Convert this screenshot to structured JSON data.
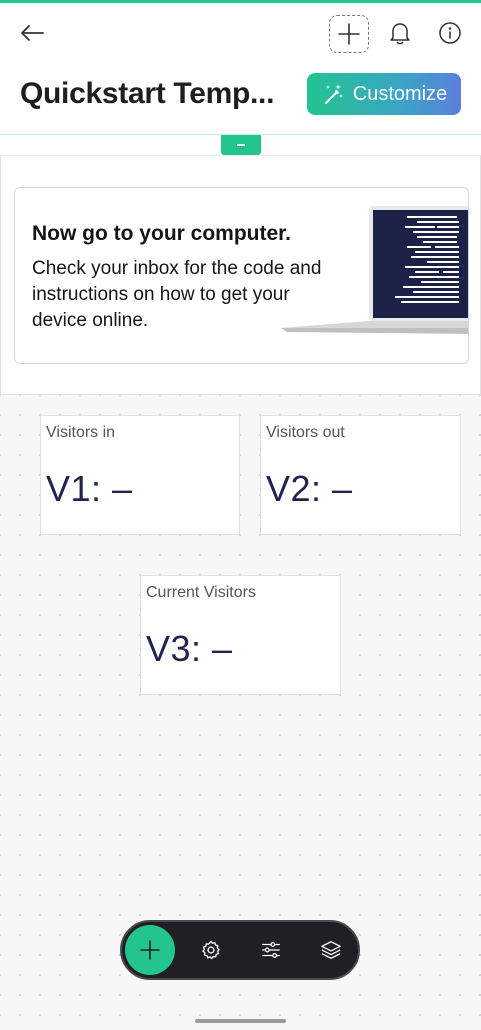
{
  "header": {
    "title": "Quickstart Temp...",
    "customize_label": "Customize",
    "icons": [
      "back-arrow-icon",
      "plus-icon",
      "bell-icon",
      "info-icon"
    ]
  },
  "banner": {
    "title": "Now go to your computer.",
    "text": "Check your inbox for the code and instructions on how to get your device online."
  },
  "widgets": [
    {
      "label": "Visitors in",
      "value": "V1: –"
    },
    {
      "label": "Visitors out",
      "value": "V2: –"
    },
    {
      "label": "Current Visitors",
      "value": "V3: –"
    }
  ],
  "toolbar": {
    "icons": [
      "plus-icon",
      "gear-icon",
      "sliders-icon",
      "layers-icon"
    ]
  },
  "colors": {
    "accent": "#23c48e",
    "gradient_end": "#5b7fdc",
    "value_text": "#1f2550",
    "toolbar_bg": "#1f1f24"
  }
}
